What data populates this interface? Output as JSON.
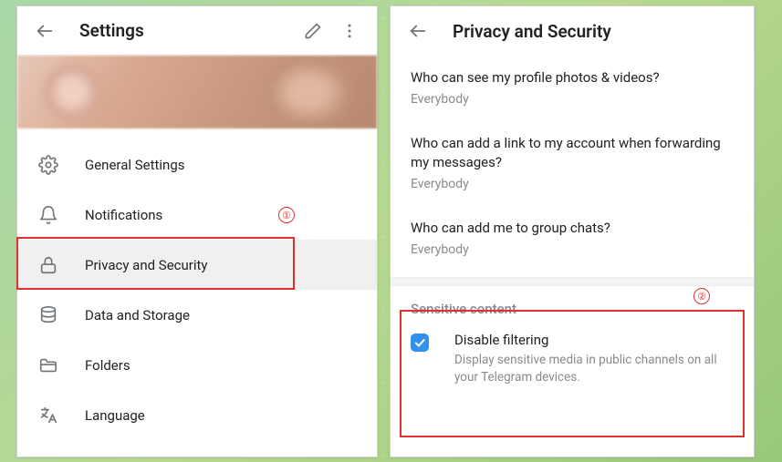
{
  "left": {
    "title": "Settings",
    "menu": [
      {
        "key": "general",
        "label": "General Settings",
        "icon": "gear-icon"
      },
      {
        "key": "notif",
        "label": "Notifications",
        "icon": "bell-icon"
      },
      {
        "key": "privacy",
        "label": "Privacy and Security",
        "icon": "lock-icon",
        "selected": true
      },
      {
        "key": "data",
        "label": "Data and Storage",
        "icon": "database-icon"
      },
      {
        "key": "folders",
        "label": "Folders",
        "icon": "folder-icon"
      },
      {
        "key": "language",
        "label": "Language",
        "icon": "language-icon"
      }
    ]
  },
  "right": {
    "title": "Privacy and Security",
    "privacy_items": [
      {
        "question": "Who can see my profile photos & videos?",
        "value": "Everybody"
      },
      {
        "question": "Who can add a link to my account when forwarding my messages?",
        "value": "Everybody"
      },
      {
        "question": "Who can add me to group chats?",
        "value": "Everybody"
      }
    ],
    "sensitive": {
      "section_label": "Sensitive content",
      "checkbox_checked": true,
      "title": "Disable filtering",
      "description": "Display sensitive media in public channels on all your Telegram devices."
    }
  },
  "annotations": {
    "callout1": "①",
    "callout2": "②"
  }
}
